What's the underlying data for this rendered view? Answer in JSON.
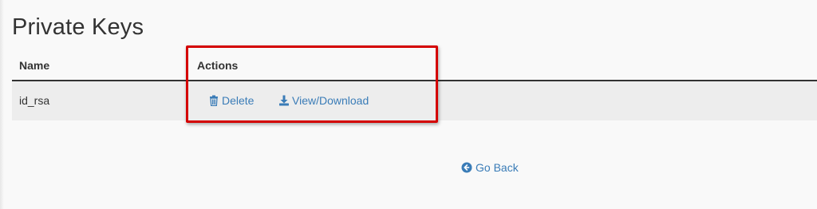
{
  "page": {
    "title": "Private Keys"
  },
  "table": {
    "columns": {
      "name": "Name",
      "actions": "Actions"
    },
    "rows": [
      {
        "name": "id_rsa",
        "actions": {
          "delete_label": "Delete",
          "download_label": "View/Download"
        }
      }
    ]
  },
  "footer": {
    "go_back_label": "Go Back"
  },
  "icons": {
    "delete": "trash-icon",
    "download": "download-icon",
    "go_back": "arrow-circle-left-icon"
  },
  "colors": {
    "link": "#3a7cb7",
    "highlight": "#d40000",
    "row_background": "#ededed",
    "text": "#333333"
  }
}
